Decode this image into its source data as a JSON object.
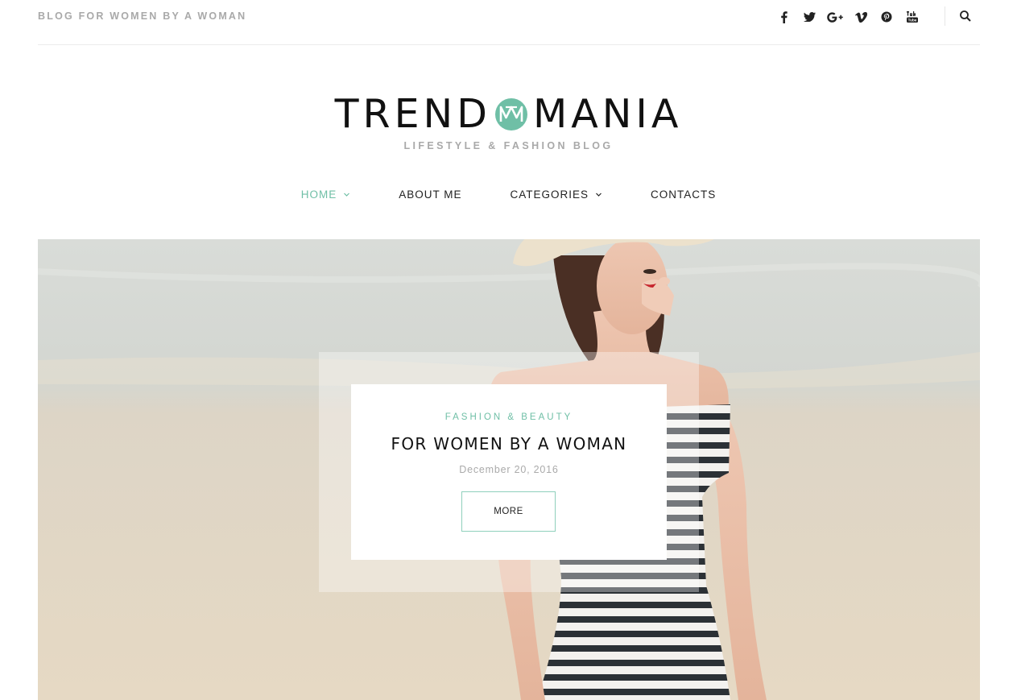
{
  "topbar": {
    "tagline": "BLOG FOR WOMEN BY A WOMAN",
    "socials": [
      {
        "name": "facebook-icon",
        "glyph": "f"
      },
      {
        "name": "twitter-icon",
        "glyph": "t"
      },
      {
        "name": "google-plus-icon",
        "glyph": "G+"
      },
      {
        "name": "vimeo-icon",
        "glyph": "v"
      },
      {
        "name": "pinterest-icon",
        "glyph": "p"
      },
      {
        "name": "youtube-icon",
        "glyph": "You"
      }
    ]
  },
  "logo": {
    "left": "TREND",
    "right": "MANIA",
    "subtitle": "LIFESTYLE & FASHION BLOG",
    "accent": "#6fbfa6"
  },
  "nav": {
    "items": [
      {
        "label": "HOME",
        "has_caret": true,
        "active": true
      },
      {
        "label": "ABOUT ME",
        "has_caret": false,
        "active": false
      },
      {
        "label": "CATEGORIES",
        "has_caret": true,
        "active": false
      },
      {
        "label": "CONTACTS",
        "has_caret": false,
        "active": false
      }
    ]
  },
  "featured": {
    "category": "FASHION & BEAUTY",
    "title": "FOR WOMEN BY A WOMAN",
    "date": "December 20, 2016",
    "button": "MORE"
  },
  "colors": {
    "accent": "#6fbfa6",
    "text": "#111111",
    "muted": "#a9a9a9"
  }
}
